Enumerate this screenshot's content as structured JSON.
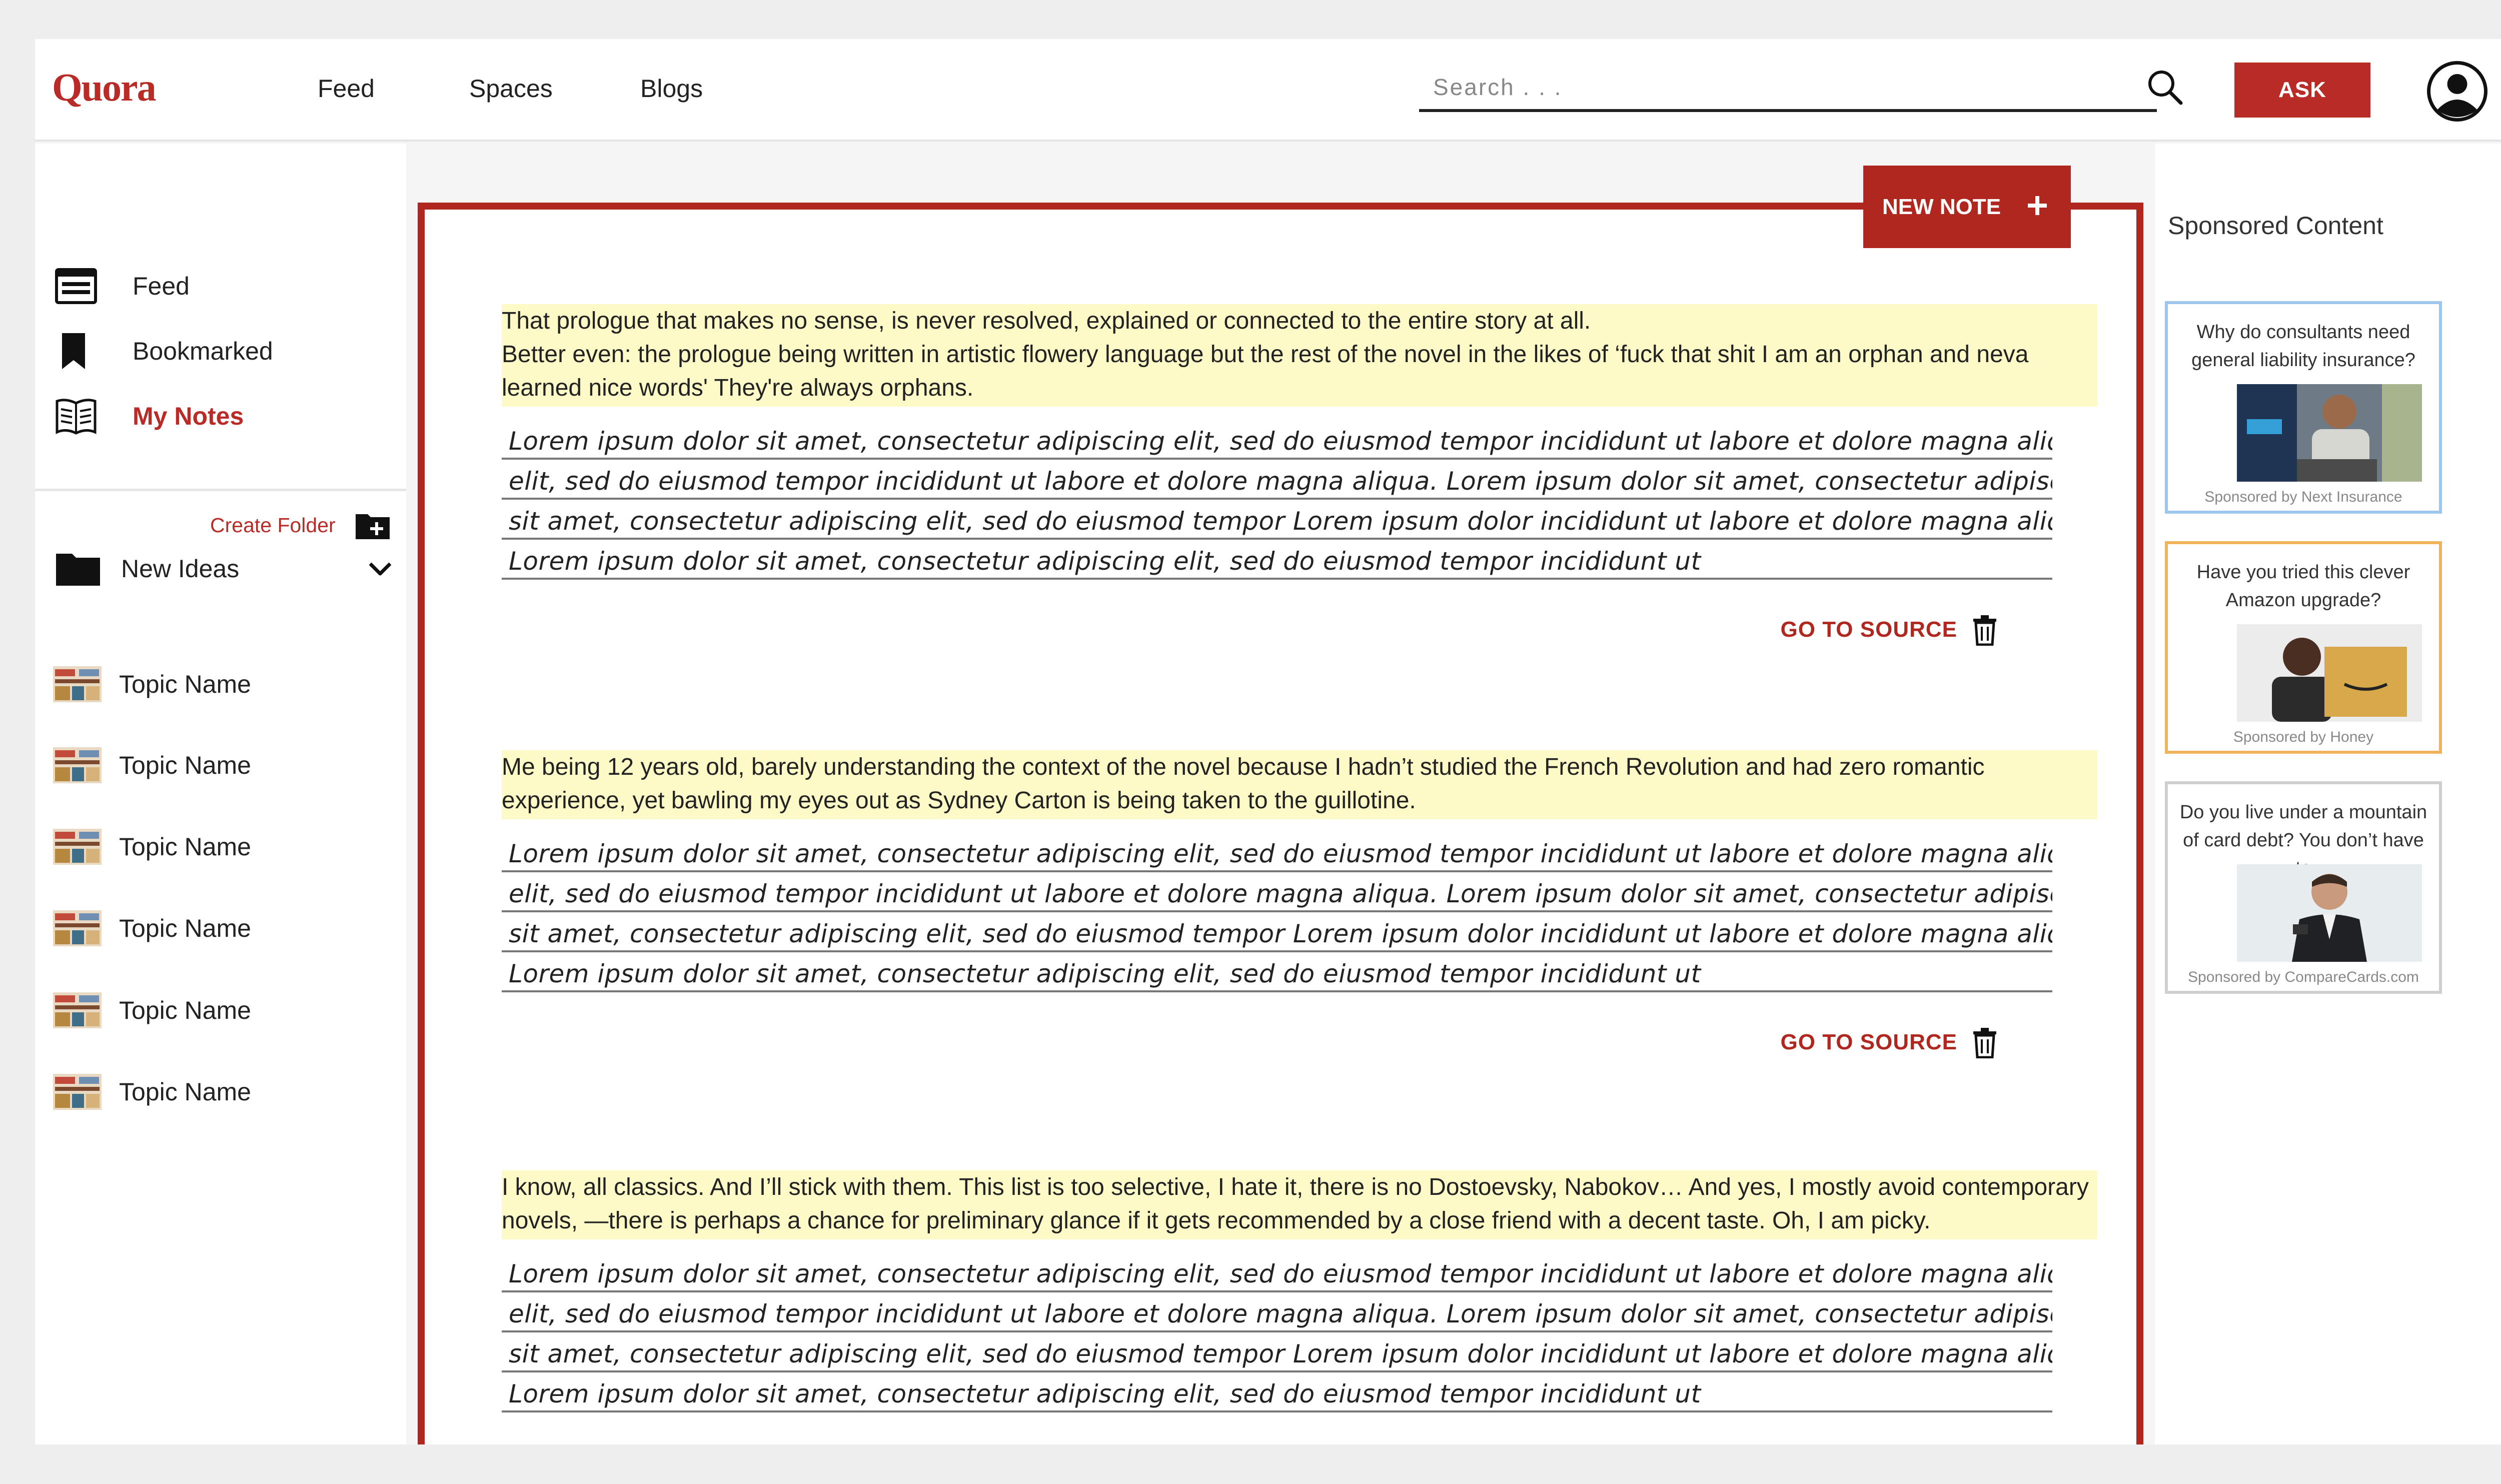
{
  "header": {
    "logo": "Quora",
    "nav": [
      "Feed",
      "Spaces",
      "Blogs"
    ],
    "search_placeholder": "Search . . .",
    "ask_label": "ASK"
  },
  "sidebar": {
    "items": [
      {
        "label": "Feed",
        "icon": "feed-icon"
      },
      {
        "label": "Bookmarked",
        "icon": "bookmark-icon"
      },
      {
        "label": "My Notes",
        "icon": "notes-book-icon",
        "active": true
      }
    ],
    "create_folder_label": "Create Folder",
    "folder": {
      "label": "New Ideas",
      "icon": "folder-icon"
    },
    "topics": [
      "Topic Name",
      "Topic Name",
      "Topic Name",
      "Topic Name",
      "Topic Name",
      "Topic Name"
    ]
  },
  "main": {
    "new_note_label": "NEW NOTE",
    "go_to_source_label": "GO TO SOURCE",
    "notes": [
      {
        "quote": "That prologue that makes no sense, is never resolved, explained or connected to the entire story at all.\nBetter even: the prologue being written in artistic flowery language but the rest of the novel in the likes of ‘fuck that shit I am an orphan and neva learned nice words' They're always orphans.",
        "lines": [
          "Lorem ipsum dolor sit amet, consectetur adipiscing elit, sed do eiusmod tempor incididunt ut labore et dolore magna aliqua. Ut enim angas",
          "elit, sed do eiusmod tempor incididunt ut labore et dolore magna aliqua. Lorem ipsum dolor sit amet, consectetur adipiscing Ut enim angas",
          "sit amet, consectetur adipiscing elit, sed do eiusmod tempor Lorem ipsum dolor incididunt ut labore et dolore magna aliqua. Ut enim angas",
          "Lorem ipsum dolor sit amet, consectetur adipiscing elit, sed do eiusmod tempor incididunt ut"
        ]
      },
      {
        "quote": "Me being 12 years old, barely understanding the context of the novel because I hadn’t studied the French Revolution and had zero romantic experience, yet bawling my eyes out as Sydney Carton is being taken to the guillotine.",
        "lines": [
          "Lorem ipsum dolor sit amet, consectetur adipiscing elit, sed do eiusmod tempor incididunt ut labore et dolore magna aliqua. Ut enim angas",
          "elit, sed do eiusmod tempor incididunt ut labore et dolore magna aliqua. Lorem ipsum dolor sit amet, consectetur adipiscing Ut enim angas",
          "sit amet, consectetur adipiscing elit, sed do eiusmod tempor Lorem ipsum dolor incididunt ut labore et dolore magna aliqua. Ut enim angas",
          "Lorem ipsum dolor sit amet, consectetur adipiscing elit, sed do eiusmod tempor incididunt ut"
        ]
      },
      {
        "quote": "I know, all classics. And I’ll stick with them. This list is too selective, I hate it, there is no Dostoevsky, Nabokov… And yes, I mostly avoid contemporary novels, —there is perhaps a chance for preliminary glance if it gets recommended by a close friend with a decent taste. Oh, I am picky.",
        "lines": [
          "Lorem ipsum dolor sit amet, consectetur adipiscing elit, sed do eiusmod tempor incididunt ut labore et dolore magna aliqua. Ut enim angas",
          "elit, sed do eiusmod tempor incididunt ut labore et dolore magna aliqua. Lorem ipsum dolor sit amet, consectetur adipiscing Ut enim angas",
          "sit amet, consectetur adipiscing elit, sed do eiusmod tempor Lorem ipsum dolor incididunt ut labore et dolore magna aliqua. Ut enim angas",
          "Lorem ipsum dolor sit amet, consectetur adipiscing elit, sed do eiusmod tempor incididunt ut"
        ]
      }
    ]
  },
  "sponsored": {
    "title": "Sponsored Content",
    "ads": [
      {
        "question": "Why do consultants need general liability insurance?",
        "by": "Sponsored by Next Insurance",
        "border": "#9ec6ec"
      },
      {
        "question": "Have you tried this clever Amazon upgrade?",
        "by": "Sponsored by Honey",
        "border": "#f0b35a"
      },
      {
        "question": "Do you live under a mountain of card debt? You don’t have to",
        "by": "Sponsored by CompareCards.com",
        "border": "#cfcfcf"
      }
    ]
  },
  "colors": {
    "brand": "#b92b27",
    "highlight": "#fdfac8"
  }
}
